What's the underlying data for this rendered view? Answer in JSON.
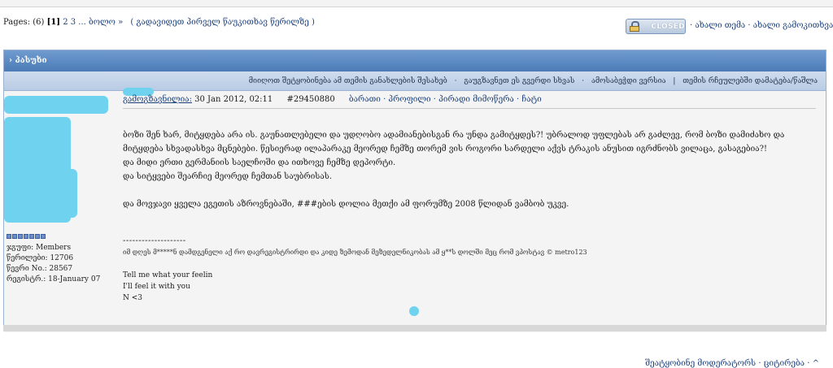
{
  "pager": {
    "prefix": "Pages: (6)",
    "current": "[1]",
    "pages": "2 3 ...",
    "next": "ბოლო »",
    "first_unread": "( გადავიდეთ პირველ წაუკითხავ წერილზე )"
  },
  "topic_status": {
    "closed_label": "CLOSED",
    "icon": "lock-icon"
  },
  "topic_links": {
    "new_topic": "· ახალი თემა",
    "new_poll": "· ახალი გამოკითხვა"
  },
  "post_header": {
    "title": "› პასუხი"
  },
  "toolbar": {
    "items": [
      "მიიღოთ შეტყობინება ამ თემის განახლების შესახებ",
      "გაუგზავნეთ ეს გვერდი სხვას",
      "ამოსაბეჭდი ვერსია",
      "თემის რჩეულებში დამატება/წაშლა"
    ]
  },
  "author": {
    "group": "ჯგუფი: Members",
    "posts": "წერილები: 12706",
    "member_no": "წევრი No.: 28567",
    "registered": "რეგისტრ.: 18-January 07"
  },
  "post_meta": {
    "author_label": "გამოგზავნილია:",
    "date": "30 Jan 2012, 02:11",
    "post_id": "#29450880",
    "actions": "ბარათი · პროფილი · პირადი მიმოწერა · ჩატი"
  },
  "message": {
    "lines": [
      "ბოზი შენ ხარ, მიტყდება არა ის. გაუნათლებელი და უდღობო ადამიანებისგან რა უნდა გამიტყდეს?! უბრალოდ უფლებას არ გაძლევ, რომ ბოზი დამიძახო და",
      "მიტყდება სხვადასხვა მცნებები. წესიერად ილაპარაკე მეორედ ჩემზე თორემ ვის როგორი სარდელი აქვს ტრაკის ანუსით იგრძნობს ვილაცა, გასაგებია?!",
      "და მიდი ერთი გერმანიის საელჩოში და ითხოვე ჩემზე დეპორტი.",
      "და სიტყვები შეარჩიე მეორედ ჩემთან საუბრისას.",
      "",
      "და მოვჯავი ყველა ეგეთის აზროვნებაში, ###ების დოლია მეთქი ამ ფორუმზე 2008 წლიდან ვამბობ უკვე."
    ]
  },
  "signature": {
    "divider": "--------------------",
    "copyright": "იმ დღეს მ*****ნ დამდგენელი აქ რო დავრეგისტრირდი და კიდე ზემოდან მეზედელნიკობას ამ ყ**ს დოლში მეც რომ ვპოსტავ © metro123",
    "lines": [
      "Tell me what your feelin",
      "I'll feel it with you",
      "N <3"
    ]
  },
  "bottom_links": {
    "report": "შეატყობინე მოდერატორს",
    "quote": "· ციტირება",
    "top": "· ^"
  }
}
